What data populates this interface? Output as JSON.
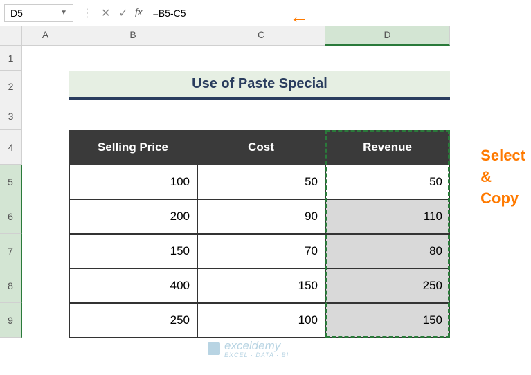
{
  "formula_bar": {
    "name_box": "D5",
    "formula": "=B5-C5"
  },
  "columns": [
    {
      "id": "A",
      "label": "A",
      "class": "col-a",
      "selected": false
    },
    {
      "id": "B",
      "label": "B",
      "class": "col-b",
      "selected": false
    },
    {
      "id": "C",
      "label": "C",
      "class": "col-c",
      "selected": false
    },
    {
      "id": "D",
      "label": "D",
      "class": "col-d",
      "selected": true
    }
  ],
  "rows": [
    {
      "num": "1",
      "class": "row-1",
      "selected": false
    },
    {
      "num": "2",
      "class": "row-2",
      "selected": false
    },
    {
      "num": "3",
      "class": "row-3",
      "selected": false
    },
    {
      "num": "4",
      "class": "row-4",
      "selected": false
    },
    {
      "num": "5",
      "class": "row-5",
      "selected": true
    },
    {
      "num": "6",
      "class": "row-6",
      "selected": true
    },
    {
      "num": "7",
      "class": "row-7",
      "selected": true
    },
    {
      "num": "8",
      "class": "row-8",
      "selected": true
    },
    {
      "num": "9",
      "class": "row-9",
      "selected": true
    }
  ],
  "title": "Use of Paste Special",
  "table": {
    "headers": [
      "Selling Price",
      "Cost",
      "Revenue"
    ],
    "rows": [
      {
        "selling": "100",
        "cost": "50",
        "revenue": "50"
      },
      {
        "selling": "200",
        "cost": "90",
        "revenue": "110"
      },
      {
        "selling": "150",
        "cost": "70",
        "revenue": "80"
      },
      {
        "selling": "400",
        "cost": "150",
        "revenue": "250"
      },
      {
        "selling": "250",
        "cost": "100",
        "revenue": "150"
      }
    ]
  },
  "annotations": {
    "arrow": "←",
    "select_copy": "Select\n&\nCopy"
  },
  "watermark": {
    "text": "exceldemy",
    "subtitle": "EXCEL · DATA · BI"
  },
  "chart_data": {
    "type": "table",
    "title": "Use of Paste Special",
    "columns": [
      "Selling Price",
      "Cost",
      "Revenue"
    ],
    "data": [
      [
        100,
        50,
        50
      ],
      [
        200,
        90,
        110
      ],
      [
        150,
        70,
        80
      ],
      [
        400,
        150,
        250
      ],
      [
        250,
        100,
        150
      ]
    ],
    "active_cell": "D5",
    "formula": "=B5-C5",
    "selection_range": "D5:D9"
  }
}
